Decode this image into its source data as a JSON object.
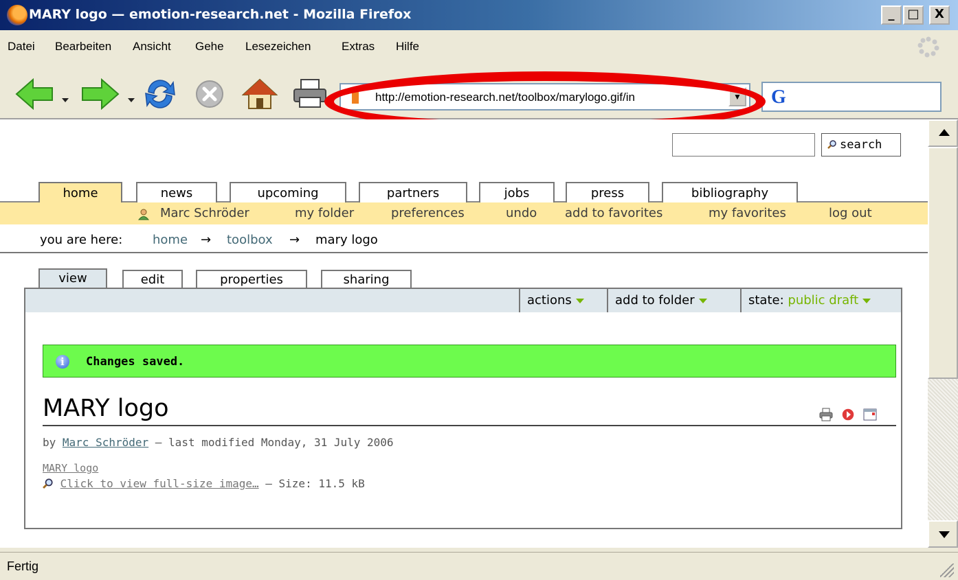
{
  "window": {
    "title": "MARY logo — emotion-research.net - Mozilla Firefox",
    "minimize": "_",
    "maximize": "□",
    "close": "X"
  },
  "menu": [
    "Datei",
    "Bearbeiten",
    "Ansicht",
    "Gehe",
    "Lesezeichen",
    "Extras",
    "Hilfe"
  ],
  "toolbar": {
    "url": "http://emotion-research.net/toolbox/marylogo.gif/in",
    "search_engine_letter": "G",
    "icons": [
      "back-arrow-icon",
      "forward-arrow-icon",
      "reload-icon",
      "stop-icon",
      "home-icon",
      "print-icon"
    ]
  },
  "site": {
    "search_button": "search",
    "global_tabs": [
      "home",
      "news",
      "upcoming",
      "partners",
      "jobs",
      "press",
      "bibliography"
    ],
    "selected_global_tab": "home",
    "user_actions": {
      "user": "Marc Schröder",
      "my_folder": "my folder",
      "preferences": "preferences",
      "undo": "undo",
      "add_to_favorites": "add to favorites",
      "my_favorites": "my favorites",
      "log_out": "log out"
    },
    "breadcrumb": {
      "prefix": "you are here:",
      "home": "home",
      "arrow": "→",
      "toolbox": "toolbox",
      "current": "mary logo"
    },
    "content_tabs": [
      "view",
      "edit",
      "properties",
      "sharing"
    ],
    "selected_content_tab": "view",
    "actions_menu": {
      "actions": "actions",
      "add_to_folder": "add to folder",
      "state_label": "state:",
      "state_value": "public draft"
    }
  },
  "document": {
    "status_message": "Changes saved.",
    "title": "MARY logo",
    "byline_prefix": "by",
    "author": "Marc Schröder",
    "byline_suffix": "— last modified Monday, 31 July 2006",
    "image_alt_link": "MARY logo",
    "fullsize_link": "Click to view full-size image…",
    "size_text": "— Size: 11.5 kB"
  },
  "statusbar": {
    "text": "Fertig"
  }
}
